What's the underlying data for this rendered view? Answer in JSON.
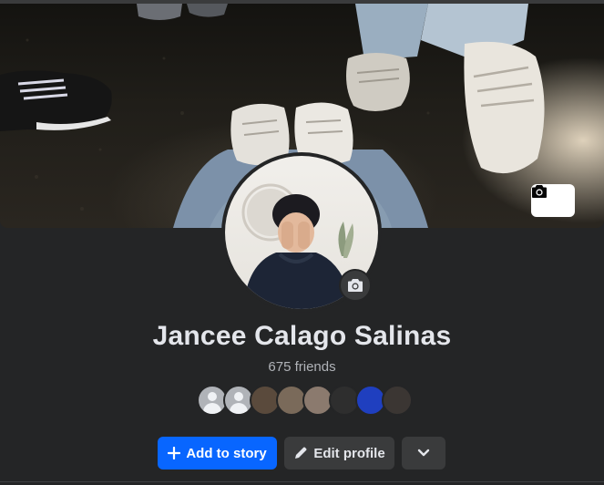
{
  "profile": {
    "name": "Jancee Calago Salinas",
    "friends_text": "675 friends"
  },
  "cover": {
    "camera_icon": "camera-icon"
  },
  "avatar": {
    "camera_icon": "camera-icon"
  },
  "friends_preview": [
    {
      "type": "default"
    },
    {
      "type": "default"
    },
    {
      "type": "photo",
      "color": "#5a4a3c"
    },
    {
      "type": "photo",
      "color": "#7a6a5a"
    },
    {
      "type": "photo",
      "color": "#8b7a6e"
    },
    {
      "type": "photo",
      "color": "#2e2e2e"
    },
    {
      "type": "photo",
      "color": "#1f3fbf"
    },
    {
      "type": "photo",
      "color": "#3b3633"
    }
  ],
  "actions": {
    "add_story_label": "Add to story",
    "edit_profile_label": "Edit profile",
    "more_icon": "chevron-down-icon"
  },
  "colors": {
    "background": "#242526",
    "primary": "#0866ff",
    "secondary_button": "#3a3b3c",
    "text": "#e4e6eb",
    "muted_text": "#b0b3b8"
  }
}
